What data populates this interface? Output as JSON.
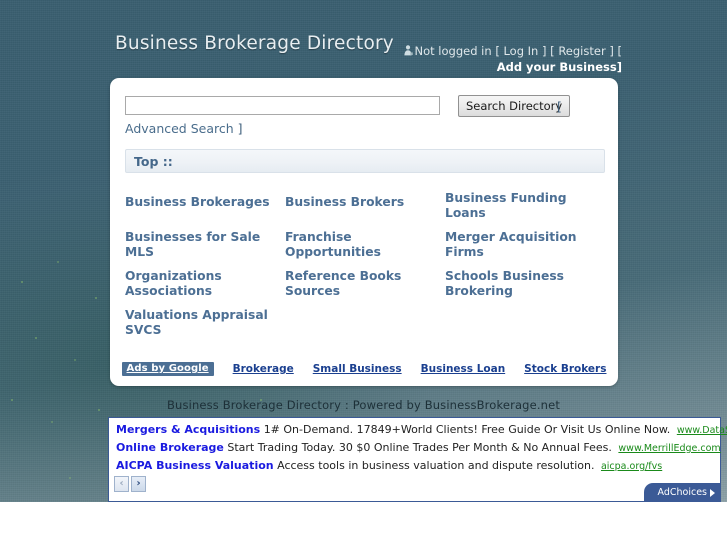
{
  "header": {
    "site_title": "Business Brokerage Directory",
    "user_status": "Not logged in",
    "bracket_l1": "[",
    "login_label": "Log In",
    "bracket_r1": "]",
    "bracket_l2": "[",
    "register_label": "Register",
    "bracket_r2": "]",
    "bracket_l3": "[",
    "add_business_label": "Add your Business",
    "bracket_r3": "]"
  },
  "search": {
    "value": "",
    "placeholder": "",
    "button_label": "Search Directory",
    "bracket_open": "[",
    "advanced_label": "Advanced Search",
    "bracket_close": "]"
  },
  "breadcrumb": {
    "label": "Top ::"
  },
  "categories": [
    [
      "Business Brokerages",
      "Business Brokers",
      "Business Funding Loans"
    ],
    [
      "Businesses for Sale MLS",
      "Franchise Opportunities",
      "Merger Acquisition Firms"
    ],
    [
      "Organizations Associations",
      "Reference Books Sources",
      "Schools Business Brokering"
    ],
    [
      "Valuations Appraisal SVCS",
      "",
      ""
    ]
  ],
  "google_ads_strip": {
    "badge": "Ads by Google",
    "links": [
      "Brokerage",
      "Small Business",
      "Business Loan",
      "Stock Brokers"
    ]
  },
  "footer": {
    "powered_by": "Business Brokerage Directory : Powered by BusinessBrokerage.net"
  },
  "ad_block": {
    "ads": [
      {
        "title": "Mergers & Acquisitions",
        "body": "1# On-Demand. 17849+World Clients! Free Guide Or Visit Us Online Now.",
        "url": "www.DataSiteDeal.com/M&A"
      },
      {
        "title": "Online Brokerage",
        "body": "Start Trading Today. 30 $0 Online Trades Per Month & No Annual Fees.",
        "url": "www.MerrillEdge.com"
      },
      {
        "title": "AICPA Business Valuation",
        "body": "Access tools in business valuation and dispute resolution.",
        "url": "aicpa.org/fvs"
      }
    ],
    "prev_glyph": "‹",
    "next_glyph": "›",
    "adchoices_label": "AdChoices"
  },
  "colors": {
    "backdrop_top": "#3a5f70",
    "backdrop_bottom": "#8ea2a8",
    "link_blue": "#4c6f94",
    "ad_border": "#3b5a96",
    "ad_title": "#1a1ae0",
    "ad_url_green": "#1a8a1a",
    "badge_bg": "#4c6f94"
  }
}
